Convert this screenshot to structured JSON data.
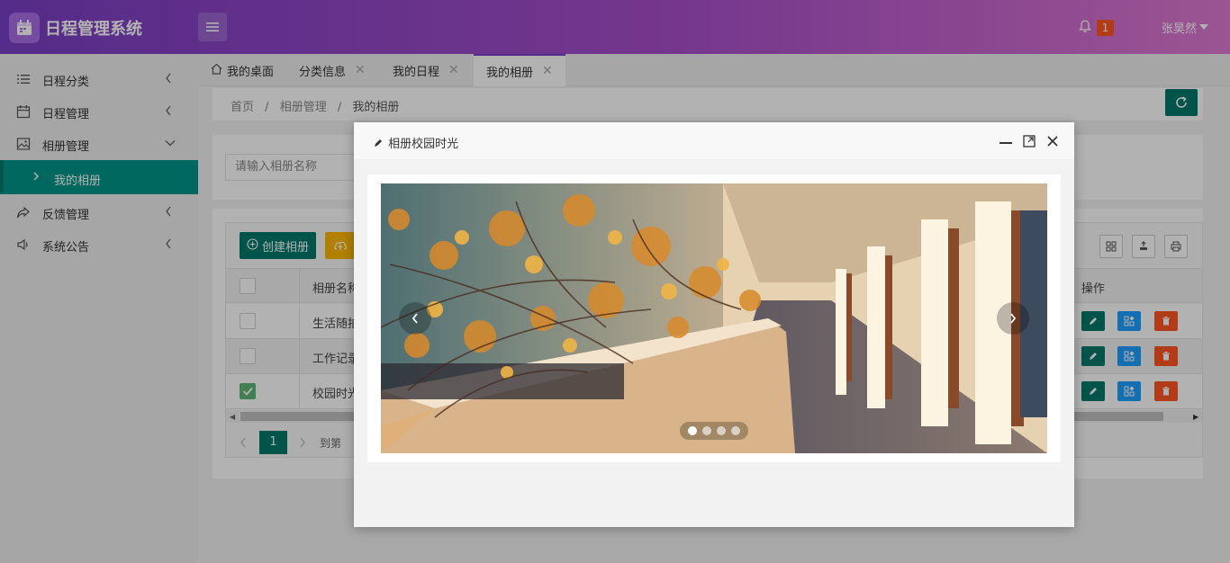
{
  "app": {
    "title": "日程管理系统"
  },
  "header": {
    "notification_count": "1",
    "user_name": "张昊然"
  },
  "sidebar": {
    "items": [
      {
        "label": "日程分类"
      },
      {
        "label": "日程管理"
      },
      {
        "label": "相册管理"
      },
      {
        "label": "我的相册"
      },
      {
        "label": "反馈管理"
      },
      {
        "label": "系统公告"
      }
    ]
  },
  "tabs": [
    {
      "label": "我的桌面"
    },
    {
      "label": "分类信息"
    },
    {
      "label": "我的日程"
    },
    {
      "label": "我的相册"
    }
  ],
  "breadcrumb": {
    "home": "首页",
    "sep": "/",
    "section": "相册管理",
    "current": "我的相册"
  },
  "search": {
    "placeholder": "请输入相册名称"
  },
  "toolbar": {
    "create_label": "创建相册"
  },
  "table": {
    "columns": [
      "相册名称",
      "操作"
    ],
    "rows": [
      {
        "name": "生活随拍",
        "checked": false
      },
      {
        "name": "工作记录",
        "checked": false
      },
      {
        "name": "校园时光",
        "checked": true
      }
    ]
  },
  "pagination": {
    "current_page": "1",
    "goto_label": "到第"
  },
  "modal": {
    "title": "相册校园时光",
    "carousel": {
      "slide_count": 4,
      "active_index": 0
    }
  },
  "colors": {
    "primary": "#00796b",
    "accent": "#7a3fc4",
    "danger": "#ff5722",
    "info": "#1e9fff",
    "warn": "#ffb800"
  }
}
